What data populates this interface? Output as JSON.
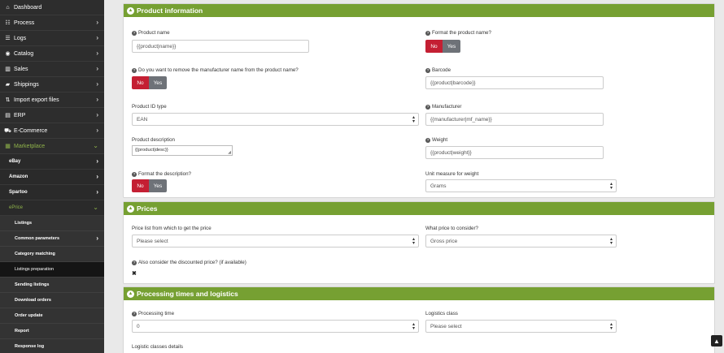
{
  "sidebar": {
    "items": [
      {
        "label": "Dashboard",
        "icon": "home-icon",
        "glyph": "⌂",
        "chevron": false
      },
      {
        "label": "Process",
        "icon": "list-icon",
        "glyph": "☷",
        "chevron": true
      },
      {
        "label": "Logs",
        "icon": "log-icon",
        "glyph": "☰",
        "chevron": true
      },
      {
        "label": "Catalog",
        "icon": "catalog-icon",
        "glyph": "◉",
        "chevron": true
      },
      {
        "label": "Sales",
        "icon": "chart-icon",
        "glyph": "▥",
        "chevron": true
      },
      {
        "label": "Shippings",
        "icon": "truck-icon",
        "glyph": "▰",
        "chevron": true
      },
      {
        "label": "Import export files",
        "icon": "import-export-icon",
        "glyph": "⇅",
        "chevron": true
      },
      {
        "label": "ERP",
        "icon": "erp-icon",
        "glyph": "▤",
        "chevron": true
      },
      {
        "label": "E-Commerce",
        "icon": "cart-icon",
        "glyph": "⛟",
        "chevron": true
      },
      {
        "label": "Marketplace",
        "icon": "marketplace-icon",
        "glyph": "▦",
        "chevron": true
      }
    ],
    "marketplace_subs": [
      {
        "label": "eBay"
      },
      {
        "label": "Amazon"
      },
      {
        "label": "Spartoo"
      },
      {
        "label": "ePrice"
      }
    ],
    "eprice_subs": [
      {
        "label": "Listings",
        "chevron": false
      },
      {
        "label": "Common parameters",
        "chevron": true
      },
      {
        "label": "Category matching",
        "chevron": false
      },
      {
        "label": "Listings preparation",
        "chevron": false
      },
      {
        "label": "Sending listings",
        "chevron": false
      },
      {
        "label": "Download orders",
        "chevron": false
      },
      {
        "label": "Order update",
        "chevron": false
      },
      {
        "label": "Report",
        "chevron": false
      },
      {
        "label": "Response log",
        "chevron": false
      }
    ]
  },
  "product_info": {
    "title": "Product information",
    "product_name_label": "Product name",
    "product_name_value": "{{product|name}}",
    "format_name_label": "Format the product name?",
    "remove_manufacturer_label": "Do you want to remove the manufacturer name from the product name?",
    "barcode_label": "Barcode",
    "barcode_value": "{{product|barcode}}",
    "product_id_type_label": "Product ID type",
    "product_id_type_value": "EAN",
    "manufacturer_label": "Manufacturer",
    "manufacturer_value": "{{manufacturer|mf_name}}",
    "description_label": "Product description",
    "description_value": "{{product|desc}}",
    "weight_label": "Weight",
    "weight_value": "{{product|weight}}",
    "format_desc_label": "Format the description?",
    "unit_weight_label": "Unit measure for weight",
    "unit_weight_value": "Grams",
    "no": "No",
    "yes": "Yes"
  },
  "prices": {
    "title": "Prices",
    "price_list_label": "Price list from which to get the price",
    "price_list_value": "Please select",
    "what_price_label": "What price to consider?",
    "what_price_value": "Gross price",
    "discounted_label": "Also consider the discounted price? (if available)",
    "discounted_value": "✖"
  },
  "processing": {
    "title": "Processing times and logistics",
    "processing_time_label": "Processing time",
    "processing_time_value": "0",
    "logistics_class_label": "Logistics class",
    "logistics_class_value": "Please select",
    "logistic_details_label": "Logistic classes details"
  },
  "scroll_top_glyph": "▲"
}
